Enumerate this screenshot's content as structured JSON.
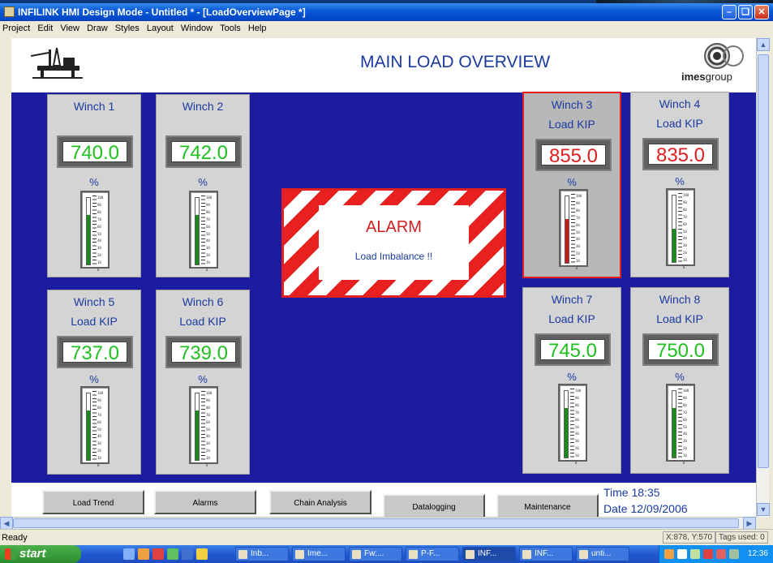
{
  "window": {
    "title": "INFILINK HMI Design Mode - Untitled * - [LoadOverviewPage *]"
  },
  "menu": [
    "Project",
    "Edit",
    "View",
    "Draw",
    "Styles",
    "Layout",
    "Window",
    "Tools",
    "Help"
  ],
  "page": {
    "title": "MAIN LOAD OVERVIEW",
    "logo_bold": "imes",
    "logo_rest": "group"
  },
  "winches": [
    {
      "name": "Winch 1",
      "sub": "",
      "value": "740.0",
      "unit": "%",
      "alarm": false,
      "level": 0.74
    },
    {
      "name": "Winch 2",
      "sub": "",
      "value": "742.0",
      "unit": "%",
      "alarm": false,
      "level": 0.74
    },
    {
      "name": "Winch 3",
      "sub": "Load KIP",
      "value": "855.0",
      "unit": "%",
      "alarm": true,
      "level": 0.66
    },
    {
      "name": "Winch 4",
      "sub": "Load KIP",
      "value": "835.0",
      "unit": "%",
      "alarm": true,
      "level": 0.5
    },
    {
      "name": "Winch 5",
      "sub": "Load KIP",
      "value": "737.0",
      "unit": "%",
      "alarm": false,
      "level": 0.74
    },
    {
      "name": "Winch 6",
      "sub": "Load KIP",
      "value": "739.0",
      "unit": "%",
      "alarm": false,
      "level": 0.74
    },
    {
      "name": "Winch 7",
      "sub": "Load KIP",
      "value": "745.0",
      "unit": "%",
      "alarm": false,
      "level": 0.75
    },
    {
      "name": "Winch 8",
      "sub": "Load KIP",
      "value": "750.0",
      "unit": "%",
      "alarm": false,
      "level": 0.75
    }
  ],
  "gauge_scale": [
    "100",
    "90",
    "80",
    "70",
    "60",
    "50",
    "40",
    "30",
    "20",
    "10",
    "0"
  ],
  "alarm": {
    "title": "ALARM",
    "message": "Load Imbalance !!"
  },
  "nav": {
    "load_trend": "Load Trend",
    "alarms": "Alarms",
    "chain_analysis": "Chain Analysis",
    "datalogging": "Datalogging",
    "maintenance": "Maintenance"
  },
  "time": {
    "time_label": "Time  18:35",
    "date_label": "Date  12/09/2006"
  },
  "status": {
    "left": "Ready",
    "coords": "X:878, Y:570",
    "tags": "Tags used: 0"
  },
  "taskbar": {
    "start": "start",
    "tasks": [
      "Inb...",
      "Ime...",
      "Fw:...",
      "P-F...",
      "INF...",
      "INF...",
      "unti..."
    ],
    "clock": "12:36"
  },
  "colors": {
    "ok": "#20c020",
    "alarm": "#e02020",
    "fill_ok": "#1a8a1a",
    "fill_alarm": "#c81818",
    "canvas": "#1c1ca0"
  }
}
